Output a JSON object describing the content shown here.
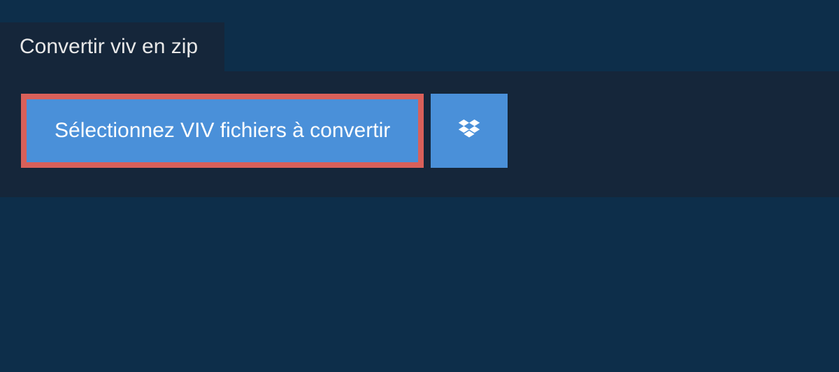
{
  "tab": {
    "label": "Convertir viv en zip"
  },
  "buttons": {
    "select_label": "Sélectionnez VIV fichiers à convertir"
  }
}
